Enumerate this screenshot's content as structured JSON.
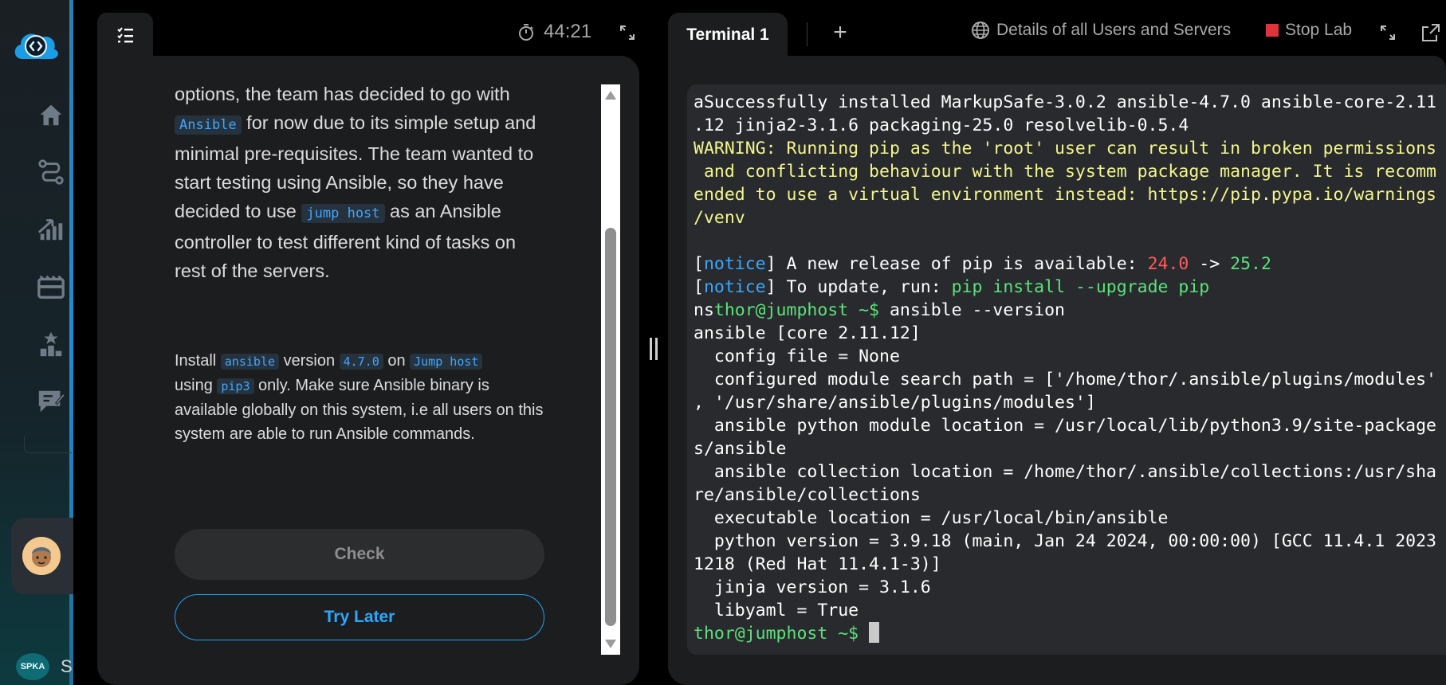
{
  "sidebar": {
    "nav": [
      "home-icon",
      "route-icon",
      "progress-icon",
      "labs-icon",
      "leaderboard-icon",
      "feedback-icon"
    ],
    "user_initials": "SPKA",
    "user_name_partial": "S"
  },
  "instructions": {
    "timer": "44:21",
    "para1": {
      "t1": "options, the team has decided to go with ",
      "code1": "Ansible",
      "t2": " for now due to its simple setup and minimal pre-requisites. The team wanted to start testing using Ansible, so they have decided to use ",
      "code2": "jump host",
      "t3": " as an Ansible controller to test different kind of tasks on rest of the servers."
    },
    "para2": {
      "t1": "Install ",
      "code1": "ansible",
      "t2": " version ",
      "code2": "4.7.0",
      "t3": " on ",
      "code3": "Jump host",
      "t4": " using ",
      "code4": "pip3",
      "t5": " only. Make sure Ansible binary is available globally on this system, i.e all users on this system are able to run Ansible commands."
    },
    "check_label": "Check",
    "try_later_label": "Try Later"
  },
  "terminal": {
    "tab_label": "Terminal 1",
    "add_tab": "+",
    "details_label": "Details of all Users and Servers",
    "stop_label": "Stop Lab",
    "lines": [
      {
        "segs": [
          {
            "t": "aSuccessfully installed MarkupSafe-3.0.2 ansible-4.7.0 ansible-core-2.11",
            "c": ""
          }
        ]
      },
      {
        "segs": [
          {
            "t": ".12 jinja2-3.1.6 packaging-25.0 resolvelib-0.5.4",
            "c": ""
          }
        ]
      },
      {
        "segs": [
          {
            "t": "WARNING: Running pip as the 'root' user can result in broken permissions",
            "c": "yellow"
          }
        ]
      },
      {
        "segs": [
          {
            "t": " and conflicting behaviour with the system package manager. It is recomm",
            "c": "yellow"
          }
        ]
      },
      {
        "segs": [
          {
            "t": "ended to use a virtual environment instead: https://pip.pypa.io/warnings",
            "c": "yellow"
          }
        ]
      },
      {
        "segs": [
          {
            "t": "/venv",
            "c": "yellow"
          }
        ]
      },
      {
        "segs": [
          {
            "t": "",
            "c": ""
          }
        ]
      },
      {
        "segs": [
          {
            "t": "[",
            "c": ""
          },
          {
            "t": "notice",
            "c": "blue"
          },
          {
            "t": "] A new release of pip is available: ",
            "c": ""
          },
          {
            "t": "24.0",
            "c": "red"
          },
          {
            "t": " -> ",
            "c": ""
          },
          {
            "t": "25.2",
            "c": "green"
          }
        ]
      },
      {
        "segs": [
          {
            "t": "[",
            "c": ""
          },
          {
            "t": "notice",
            "c": "blue"
          },
          {
            "t": "] To update, run: ",
            "c": ""
          },
          {
            "t": "pip install --upgrade pip",
            "c": "green"
          }
        ]
      },
      {
        "segs": [
          {
            "t": "ns",
            "c": ""
          },
          {
            "t": "thor@jumphost ~$",
            "c": "green"
          },
          {
            "t": " ansible --version",
            "c": ""
          }
        ]
      },
      {
        "segs": [
          {
            "t": "ansible [core 2.11.12]",
            "c": ""
          }
        ]
      },
      {
        "segs": [
          {
            "t": "  config file = None",
            "c": ""
          }
        ]
      },
      {
        "segs": [
          {
            "t": "  configured module search path = ['/home/thor/.ansible/plugins/modules'",
            "c": ""
          }
        ]
      },
      {
        "segs": [
          {
            "t": ", '/usr/share/ansible/plugins/modules']",
            "c": ""
          }
        ]
      },
      {
        "segs": [
          {
            "t": "  ansible python module location = /usr/local/lib/python3.9/site-package",
            "c": ""
          }
        ]
      },
      {
        "segs": [
          {
            "t": "s/ansible",
            "c": ""
          }
        ]
      },
      {
        "segs": [
          {
            "t": "  ansible collection location = /home/thor/.ansible/collections:/usr/sha",
            "c": ""
          }
        ]
      },
      {
        "segs": [
          {
            "t": "re/ansible/collections",
            "c": ""
          }
        ]
      },
      {
        "segs": [
          {
            "t": "  executable location = /usr/local/bin/ansible",
            "c": ""
          }
        ]
      },
      {
        "segs": [
          {
            "t": "  python version = 3.9.18 (main, Jan 24 2024, 00:00:00) [GCC 11.4.1 2023",
            "c": ""
          }
        ]
      },
      {
        "segs": [
          {
            "t": "1218 (Red Hat 11.4.1-3)]",
            "c": ""
          }
        ]
      },
      {
        "segs": [
          {
            "t": "  jinja version = 3.1.6",
            "c": ""
          }
        ]
      },
      {
        "segs": [
          {
            "t": "  libyaml = True",
            "c": ""
          }
        ]
      },
      {
        "segs": [
          {
            "t": "thor@jumphost ~$",
            "c": "green"
          },
          {
            "t": " ",
            "c": ""
          }
        ],
        "cursor": true
      }
    ]
  },
  "colors": {
    "accent": "#1ea2f0",
    "stop": "#e0343d",
    "terminal_bg": "#282a2e"
  }
}
